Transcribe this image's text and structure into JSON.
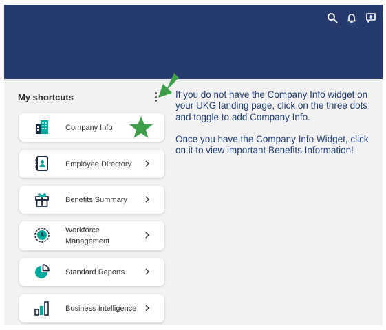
{
  "header": {
    "icons": [
      "search-icon",
      "bell-icon",
      "add-comment-icon"
    ],
    "color": "#263a6e"
  },
  "shortcuts": {
    "title": "My shortcuts",
    "items": [
      {
        "label": "Company Info",
        "icon": "building-icon"
      },
      {
        "label": "Employee Directory",
        "icon": "contact-book-icon"
      },
      {
        "label": "Benefits Summary",
        "icon": "gift-icon"
      },
      {
        "label": "Workforce Management",
        "icon": "clock-icon"
      },
      {
        "label": "Standard Reports",
        "icon": "pie-chart-icon"
      },
      {
        "label": "Business Intelligence",
        "icon": "bar-chart-icon"
      }
    ]
  },
  "annotation": {
    "paragraph1": "If you do not have the Company Info widget on your UKG landing page, click on the three dots and toggle to add Company Info.",
    "paragraph2": "Once you have the Company Info Widget, click on it to view important Benefits Information!",
    "highlight_color": "#3f9e4a",
    "text_color": "#1f3f7a"
  },
  "colors": {
    "icon_teal": "#00a79d",
    "icon_dark": "#1c2b4a",
    "panel_bg": "#f2f2f2"
  }
}
